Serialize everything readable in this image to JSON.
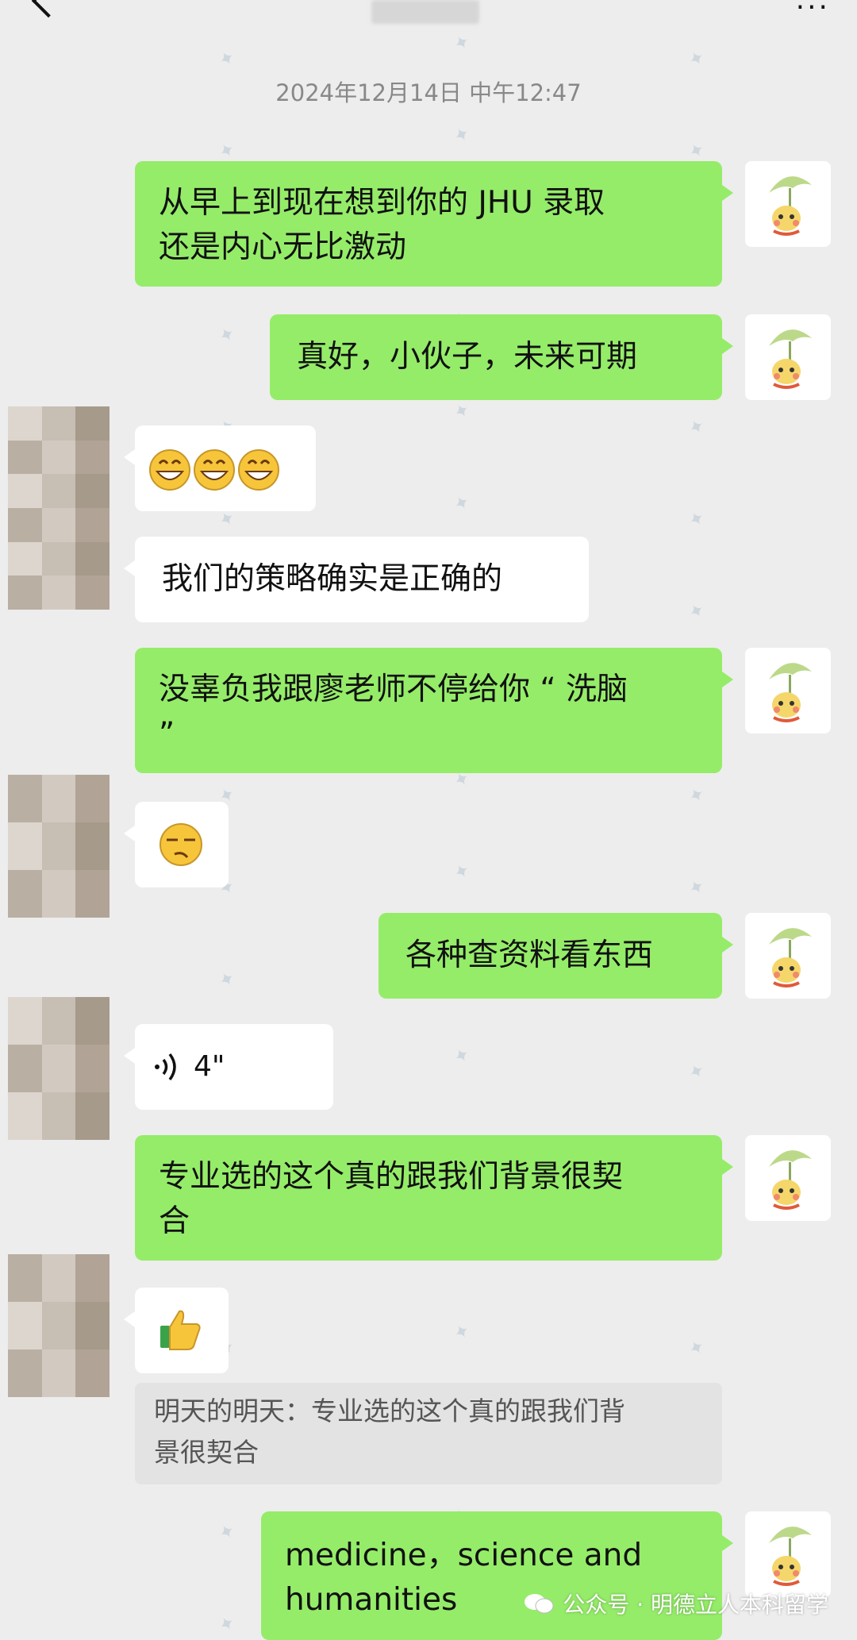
{
  "header": {
    "more_label": "···"
  },
  "timestamp": "2024年12月14日 中午12:47",
  "messages": [
    {
      "side": "out",
      "text": "从早上到现在想到你的 JHU 录取\n还是内心无比激动"
    },
    {
      "side": "out",
      "text": "真好，小伙子，未来可期"
    },
    {
      "side": "in",
      "emoji": "grinning-face-x3"
    },
    {
      "side": "in",
      "text": "我们的策略确实是正确的"
    },
    {
      "side": "out",
      "text": "没辜负我跟廖老师不停给你 “ 洗脑\n”"
    },
    {
      "side": "in",
      "emoji": "smirk-face"
    },
    {
      "side": "out",
      "text": "各种查资料看东西"
    },
    {
      "side": "in",
      "voice_duration": "4\""
    },
    {
      "side": "out",
      "text": "专业选的这个真的跟我们背景很契\n合"
    },
    {
      "side": "in",
      "emoji": "thumbs-up"
    },
    {
      "side": "out",
      "text": "medicine，science and\nhumanities"
    }
  ],
  "quote": {
    "text": "明天的明天：专业选的这个真的跟我们背\n景很契合"
  },
  "footer": {
    "label": "公众号 · 明德立人本科留学"
  },
  "colors": {
    "outgoing_bubble": "#95ec69",
    "incoming_bubble": "#ffffff",
    "background": "#ededed"
  }
}
